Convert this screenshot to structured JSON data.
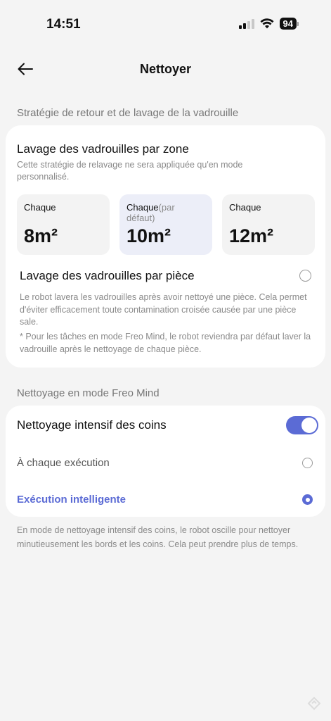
{
  "status": {
    "time": "14:51",
    "battery": "94"
  },
  "header": {
    "title": "Nettoyer"
  },
  "section_return": {
    "label": "Stratégie de retour et de lavage de la vadrouille"
  },
  "zone": {
    "title": "Lavage des vadrouilles par zone",
    "description": "Cette stratégie de relavage ne sera appliquée qu'en mode personnalisé.",
    "options": [
      {
        "label": "Chaque",
        "sub": "",
        "value": "8m²",
        "selected": false
      },
      {
        "label": "Chaque",
        "sub": "(par défaut)",
        "value": "10m²",
        "selected": true
      },
      {
        "label": "Chaque",
        "sub": "",
        "value": "12m²",
        "selected": false
      }
    ]
  },
  "piece": {
    "title": "Lavage des vadrouilles par pièce",
    "description": "Le robot lavera les vadrouilles après avoir nettoyé une pièce. Cela permet d'éviter efficacement toute contamination croisée causée par une pièce sale.",
    "note": " * Pour les tâches en mode Freo Mind, le robot reviendra par défaut laver la vadrouille après le nettoyage de chaque pièce."
  },
  "section_freo": {
    "label": "Nettoyage en mode Freo Mind"
  },
  "coins": {
    "title": "Nettoyage intensif des coins",
    "toggle_on": true,
    "options": [
      {
        "label": "À chaque exécution",
        "checked": false
      },
      {
        "label": "Exécution intelligente",
        "checked": true
      }
    ],
    "footer": "En mode de nettoyage intensif des coins, le robot oscille pour nettoyer minutieusement les bords et les coins. Cela peut prendre plus de temps."
  },
  "colors": {
    "accent": "#5b6bd5",
    "background": "#f4f4f4",
    "muted_text": "#8a8a8a"
  },
  "icons": {
    "back": "arrow-left-icon",
    "signal": "cellular-signal-icon",
    "wifi": "wifi-icon",
    "battery": "battery-icon"
  }
}
